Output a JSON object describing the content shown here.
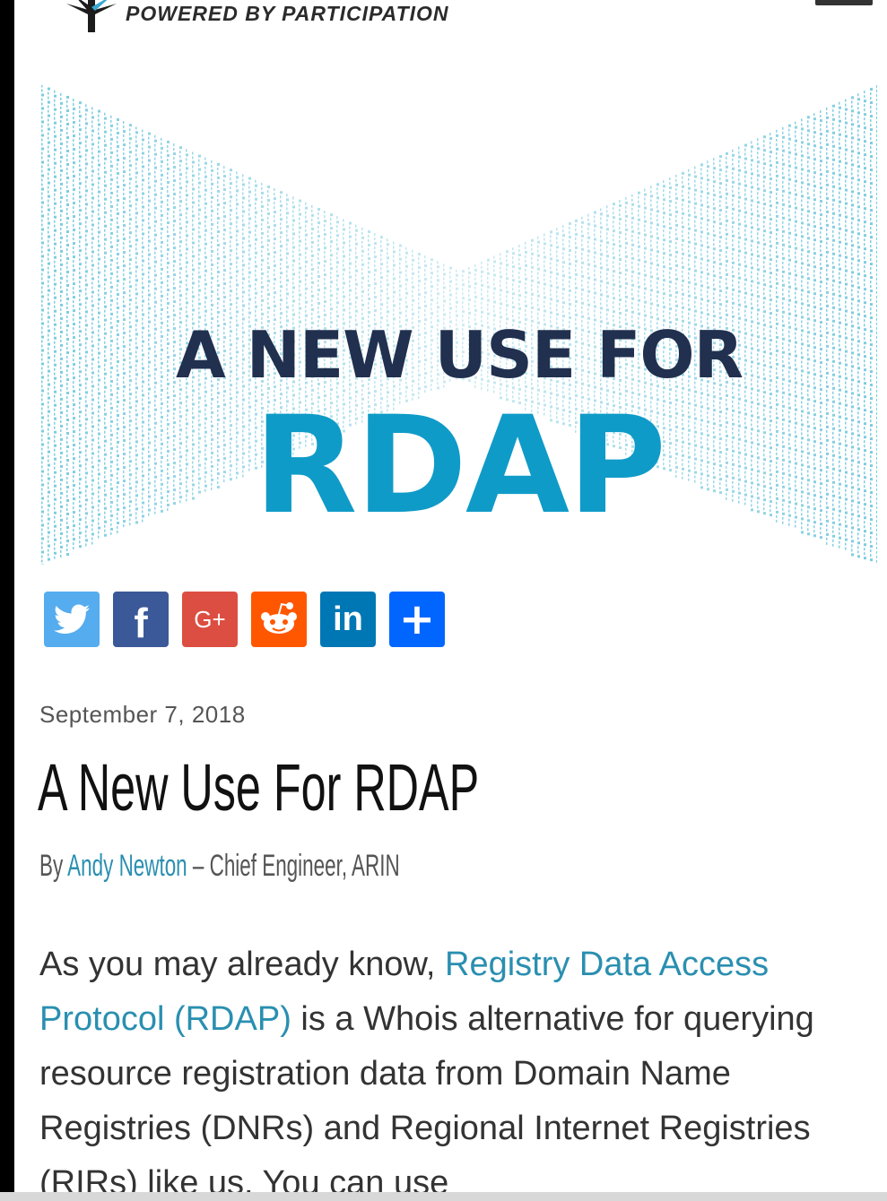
{
  "header": {
    "tagline": "POWERED BY PARTICIPATION"
  },
  "hero": {
    "line1": "A NEW USE FOR",
    "line2": "RDAP"
  },
  "share": {
    "buttons": [
      {
        "name": "twitter",
        "color": "#55acee"
      },
      {
        "name": "facebook",
        "color": "#3b5998"
      },
      {
        "name": "google-plus",
        "color": "#dc4e41"
      },
      {
        "name": "reddit",
        "color": "#ff5700"
      },
      {
        "name": "linkedin",
        "color": "#0077b5"
      },
      {
        "name": "more",
        "color": "#0166ff"
      }
    ]
  },
  "post": {
    "date": "September 7, 2018",
    "title": "A New Use For RDAP",
    "byline_prefix": "By ",
    "author": "Andy Newton",
    "byline_suffix": " – Chief Engineer, ARIN",
    "body": {
      "before_link": "As you may already know, ",
      "link_text": "Registry Data Access Protocol (RDAP)",
      "after_link": " is a Whois alternative for querying resource registration data from Domain Name Registries (DNRs) and Regional Internet Registries (RIRs) like us. You can use"
    }
  },
  "colors": {
    "accent": "#0f9bc8",
    "navy": "#21304f",
    "link": "#2a8fb0"
  }
}
